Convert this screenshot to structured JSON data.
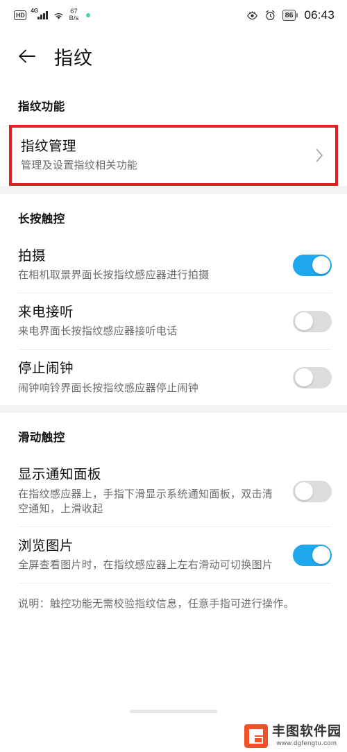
{
  "status_bar": {
    "hd_label": "HD",
    "network_generation": "4G",
    "net_speed_value": "67",
    "net_speed_unit": "B/s",
    "signal_icon": "signal-bars-icon",
    "wifi_icon": "wifi-icon",
    "green_dot_icon": "recording-indicator-icon",
    "eye_icon": "eye-comfort-icon",
    "alarm_icon": "alarm-clock-icon",
    "battery_percent": "86",
    "clock": "06:43"
  },
  "appbar": {
    "back_icon": "back-arrow-icon",
    "title": "指纹"
  },
  "sections": [
    {
      "header": "指纹功能",
      "rows": [
        {
          "title": "指纹管理",
          "subtitle": "管理及设置指纹相关功能",
          "control": "chevron",
          "highlighted": true,
          "chevron_icon": "chevron-right-icon"
        }
      ]
    },
    {
      "header": "长按触控",
      "rows": [
        {
          "title": "拍摄",
          "subtitle": "在相机取景界面长按指纹感应器进行拍摄",
          "control": "toggle",
          "toggle_on": true
        },
        {
          "title": "来电接听",
          "subtitle": "来电界面长按指纹感应器接听电话",
          "control": "toggle",
          "toggle_on": false
        },
        {
          "title": "停止闹钟",
          "subtitle": "闹钟响铃界面长按指纹感应器停止闹钟",
          "control": "toggle",
          "toggle_on": false
        }
      ]
    },
    {
      "header": "滑动触控",
      "rows": [
        {
          "title": "显示通知面板",
          "subtitle": "在指纹感应器上，手指下滑显示系统通知面板，双击清空通知，上滑收起",
          "control": "toggle",
          "toggle_on": false
        },
        {
          "title": "浏览图片",
          "subtitle": "全屏查看图片时，在指纹感应器上左右滑动可切换图片",
          "control": "toggle",
          "toggle_on": true
        }
      ],
      "note": "说明：触控功能无需校验指纹信息，任意手指可进行操作。"
    }
  ],
  "colors": {
    "toggle_on": "#1ea7ed",
    "toggle_off": "#dcdcdc",
    "highlight_border": "#e02020",
    "section_gap": "#f3f3f3",
    "watermark_brand": "#f0502a"
  },
  "watermark": {
    "brand_cn": "丰图软件园",
    "url": "www.dgfengtu.com",
    "logo_icon": "fengtu-logo-icon"
  },
  "gesture_bar": {
    "icon": "home-gesture-bar"
  }
}
